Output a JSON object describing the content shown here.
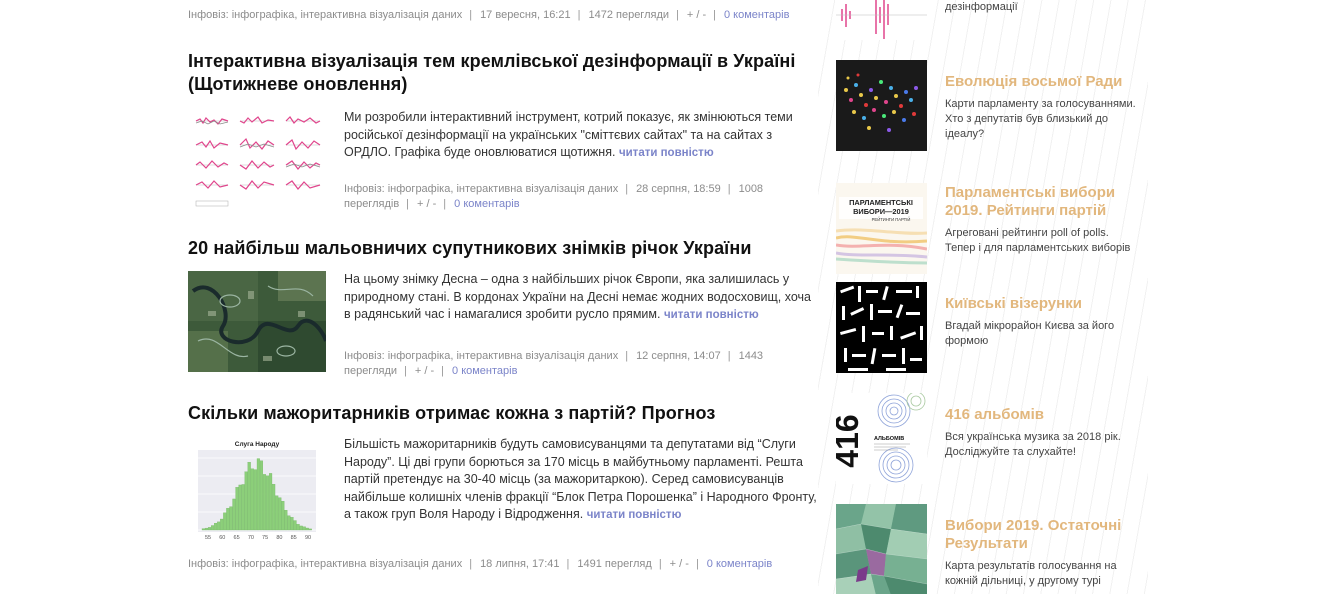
{
  "top_meta": {
    "category": "Інфовіз: інфографіка, інтерактивна візуалізація даних",
    "date": "17 вересня, 16:21",
    "views": "1472 перегляди",
    "votes": "+ / -",
    "comments": "0 коментарів"
  },
  "articles": [
    {
      "title": "Інтерактивна візуалізація тем кремлівської дезінформації в Україні (Щотижневе оновлення)",
      "excerpt": "Ми розробили інтерактивний інструмент, котрий показує, як змінюються теми російської дезінформації на українських \"сміттєвих сайтах\" та на сайтах з ОРДЛО. Графіка буде оновлюватися щотижня.",
      "more": "читати повністю",
      "category": "Інфовіз: інфографіка, інтерактивна візуалізація даних",
      "date": "28 серпня, 18:59",
      "views": "1008 переглядів",
      "votes": "+ / -",
      "comments": "0 коментарів"
    },
    {
      "title": "20 найбільш мальовничих супутникових знімків річок України",
      "excerpt": "На цьому знімку Десна – одна з найбільших річок Європи, яка залишилась у природному стані. В кордонах України на Десні немає жодних водосховищ, хоча в радянський час і намагалися зробити русло прямим.",
      "more": "читати повністю",
      "category": "Інфовіз: інфографіка, інтерактивна візуалізація даних",
      "date": "12 серпня, 14:07",
      "views": "1443 перегляди",
      "votes": "+ / -",
      "comments": "0 коментарів"
    },
    {
      "title": "Скільки мажоритарників отримає кожна з партій? Прогноз",
      "excerpt": "Більшість мажоритарників будуть самовисуванцями та депутатами від “Слуги Народу”. Ці дві групи борються за 170 місць в майбутньому парламенті. Решта партій претендує на 30-40 місць (за мажоритаркою). Серед самовисуванців найбільше колишніх членів фракції “Блок Петра Порошенка” і Народного Фронту, а також груп Воля Народу і Відродження.",
      "more": "читати повністю",
      "category": "Інфовіз: інфографіка, інтерактивна візуалізація даних",
      "date": "18 липня, 17:41",
      "views": "1491 перегляд",
      "votes": "+ / -",
      "comments": "0 коментарів",
      "thumb_chart": {
        "title": "Слуга Народу",
        "ticks": [
          "55",
          "60",
          "65",
          "70",
          "75",
          "80",
          "85",
          "90"
        ]
      }
    }
  ],
  "sidebar": {
    "items": [
      {
        "title": "",
        "desc": "дезінформації"
      },
      {
        "title": "Еволюція восьмої Ради",
        "desc": "Карти парламенту за голосуваннями. Хто з депутатів був близький до ідеалу?"
      },
      {
        "title": "Парламентські вибори 2019. Рейтинги партій",
        "desc": "Агреговані рейтинги poll of polls. Тепер і для парламентських виборів",
        "thumb_text": [
          "ПАРЛАМЕНТСЬКІ",
          "ВИБОРИ—2019",
          "РЕЙТИНГИ ПАРТІЙ"
        ]
      },
      {
        "title": "Київські візерунки",
        "desc": "Вгадай мікрорайон Києва за його формою"
      },
      {
        "title": "416 альбомів",
        "desc": "Вся українська музика за 2018 рік. Досліджуйте та слухайте!",
        "thumb_text": [
          "416",
          "АЛЬБОМІВ"
        ]
      },
      {
        "title": "Вибори 2019. Остаточні Результати",
        "desc": "Карта результатів голосування на кожній дільниці, у другому турі"
      }
    ]
  },
  "colors": {
    "link": "#7b84c9",
    "sidebar_title": "#e2b77d",
    "meta": "#8c8c8c"
  }
}
